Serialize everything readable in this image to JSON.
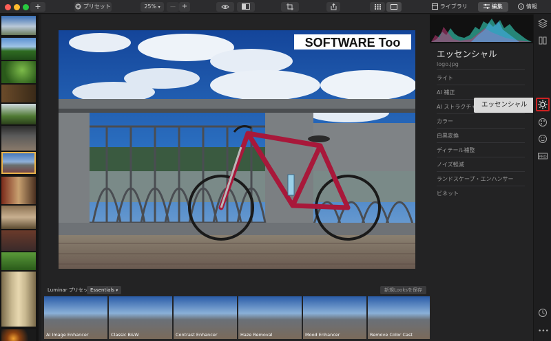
{
  "toolbar": {
    "add_label": "+",
    "presets_label": "プリセット",
    "zoom_value": "25%",
    "zoom_minus": "—",
    "zoom_plus": "+",
    "library_tab": "ライブラリ",
    "edit_tab": "編集",
    "info_tab": "情報"
  },
  "image": {
    "watermark": "SOFTWARE Too"
  },
  "panel": {
    "title": "エッセンシャル",
    "filename": "logo.jpg",
    "sections": [
      "ライト",
      "AI 補正",
      "AI ストラクチャー",
      "カラー",
      "白黒変換",
      "ディテール補整",
      "ノイズ軽減",
      "ランドスケープ・エンハンサー",
      "ビネット"
    ]
  },
  "tooltip": {
    "label": "エッセンシャル"
  },
  "presets": {
    "prefix": "Luminar プリセット",
    "category": "Essentials",
    "save_looks_label": "新規Looksを保存",
    "items": [
      {
        "label": "AI Image Enhancer"
      },
      {
        "label": "Classic B&W"
      },
      {
        "label": "Contrast Enhancer"
      },
      {
        "label": "Haze Removal"
      },
      {
        "label": "Mood Enhancer"
      },
      {
        "label": "Remove Color Cast"
      }
    ]
  },
  "colors": {
    "accent_active": "#cc2222",
    "bike_red": "#a8183a",
    "sky": "#1d4f9a"
  }
}
